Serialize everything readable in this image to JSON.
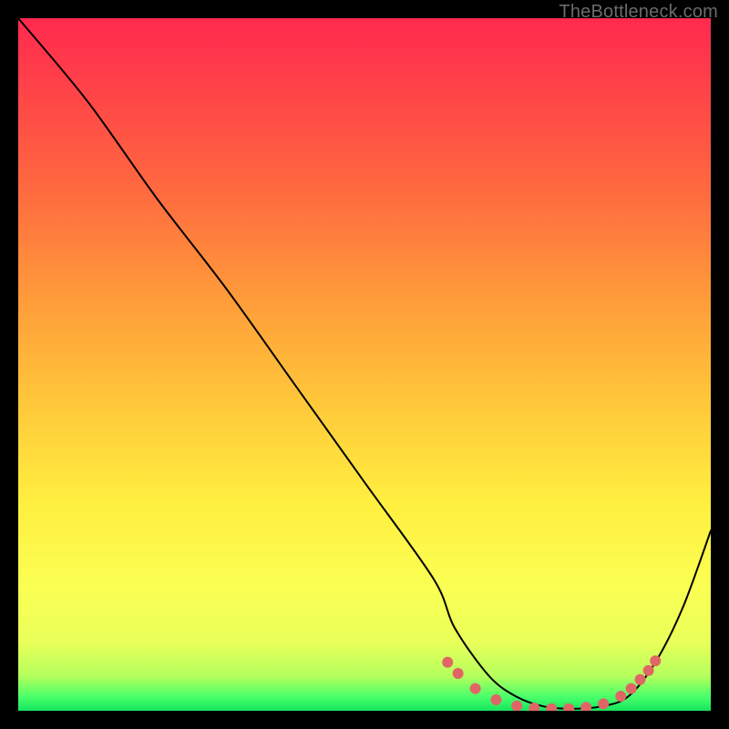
{
  "watermark": "TheBottleneck.com",
  "chart_data": {
    "type": "line",
    "title": "",
    "xlabel": "",
    "ylabel": "",
    "xlim": [
      0,
      100
    ],
    "ylim": [
      0,
      100
    ],
    "grid": false,
    "legend": false,
    "series": [
      {
        "name": "bottleneck-curve",
        "color": "#000000",
        "x": [
          0,
          10,
          20,
          30,
          40,
          50,
          60,
          63,
          68,
          72,
          76,
          80,
          84,
          88,
          92,
          96,
          100
        ],
        "y": [
          100,
          88,
          74,
          61,
          47,
          33,
          19,
          12,
          5,
          2,
          0.6,
          0.3,
          0.6,
          2,
          7,
          15,
          26
        ]
      }
    ],
    "markers": {
      "name": "curve-dots",
      "color": "#e06666",
      "radius_px": 6,
      "x": [
        62,
        63.5,
        66,
        69,
        72,
        74.5,
        77,
        79.5,
        82,
        84.5,
        87,
        88.5,
        89.8,
        91,
        92
      ],
      "y": [
        7,
        5.4,
        3.2,
        1.6,
        0.7,
        0.4,
        0.3,
        0.3,
        0.5,
        1.0,
        2.1,
        3.2,
        4.5,
        5.8,
        7.2
      ]
    }
  }
}
